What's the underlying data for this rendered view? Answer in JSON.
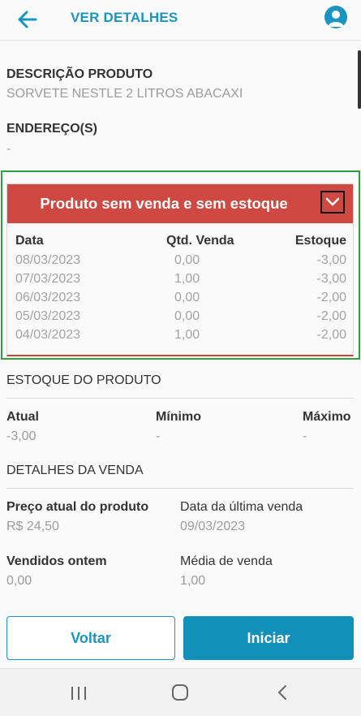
{
  "appbar": {
    "title": "VER DETALHES",
    "back_icon": "arrow-left-icon",
    "avatar_icon": "user-avatar-icon"
  },
  "product": {
    "description_label": "DESCRIÇÃO PRODUTO",
    "description_value": "SORVETE NESTLE 2 LITROS ABACAXI",
    "address_label": "ENDEREÇO(S)",
    "address_value": "-"
  },
  "alert_card": {
    "title": "Produto sem venda e sem estoque",
    "header_color": "#cf4942",
    "columns": [
      "Data",
      "Qtd. Venda",
      "Estoque"
    ],
    "rows": [
      [
        "08/03/2023",
        "0,00",
        "-3,00"
      ],
      [
        "07/03/2023",
        "1,00",
        "-3,00"
      ],
      [
        "06/03/2023",
        "0,00",
        "-2,00"
      ],
      [
        "05/03/2023",
        "0,00",
        "-2,00"
      ],
      [
        "04/03/2023",
        "1,00",
        "-2,00"
      ]
    ]
  },
  "stock": {
    "section_title": "ESTOQUE DO PRODUTO",
    "current_label": "Atual",
    "current_value": "-3,00",
    "min_label": "Mínimo",
    "min_value": "-",
    "max_label": "Máximo",
    "max_value": "-"
  },
  "sale": {
    "section_title": "DETALHES DA VENDA",
    "price_label": "Preço atual do produto",
    "price_value": "R$ 24,50",
    "last_sale_label": "Data da última venda",
    "last_sale_value": "09/03/2023",
    "sold_yesterday_label": "Vendidos ontem",
    "sold_yesterday_value": "0,00",
    "avg_label": "Média de venda",
    "avg_value": "1,00"
  },
  "actions": {
    "back_label": "Voltar",
    "start_label": "Iniciar"
  },
  "colors": {
    "accent": "#1a95c2",
    "danger": "#cf4942",
    "highlight": "#2ea043"
  }
}
